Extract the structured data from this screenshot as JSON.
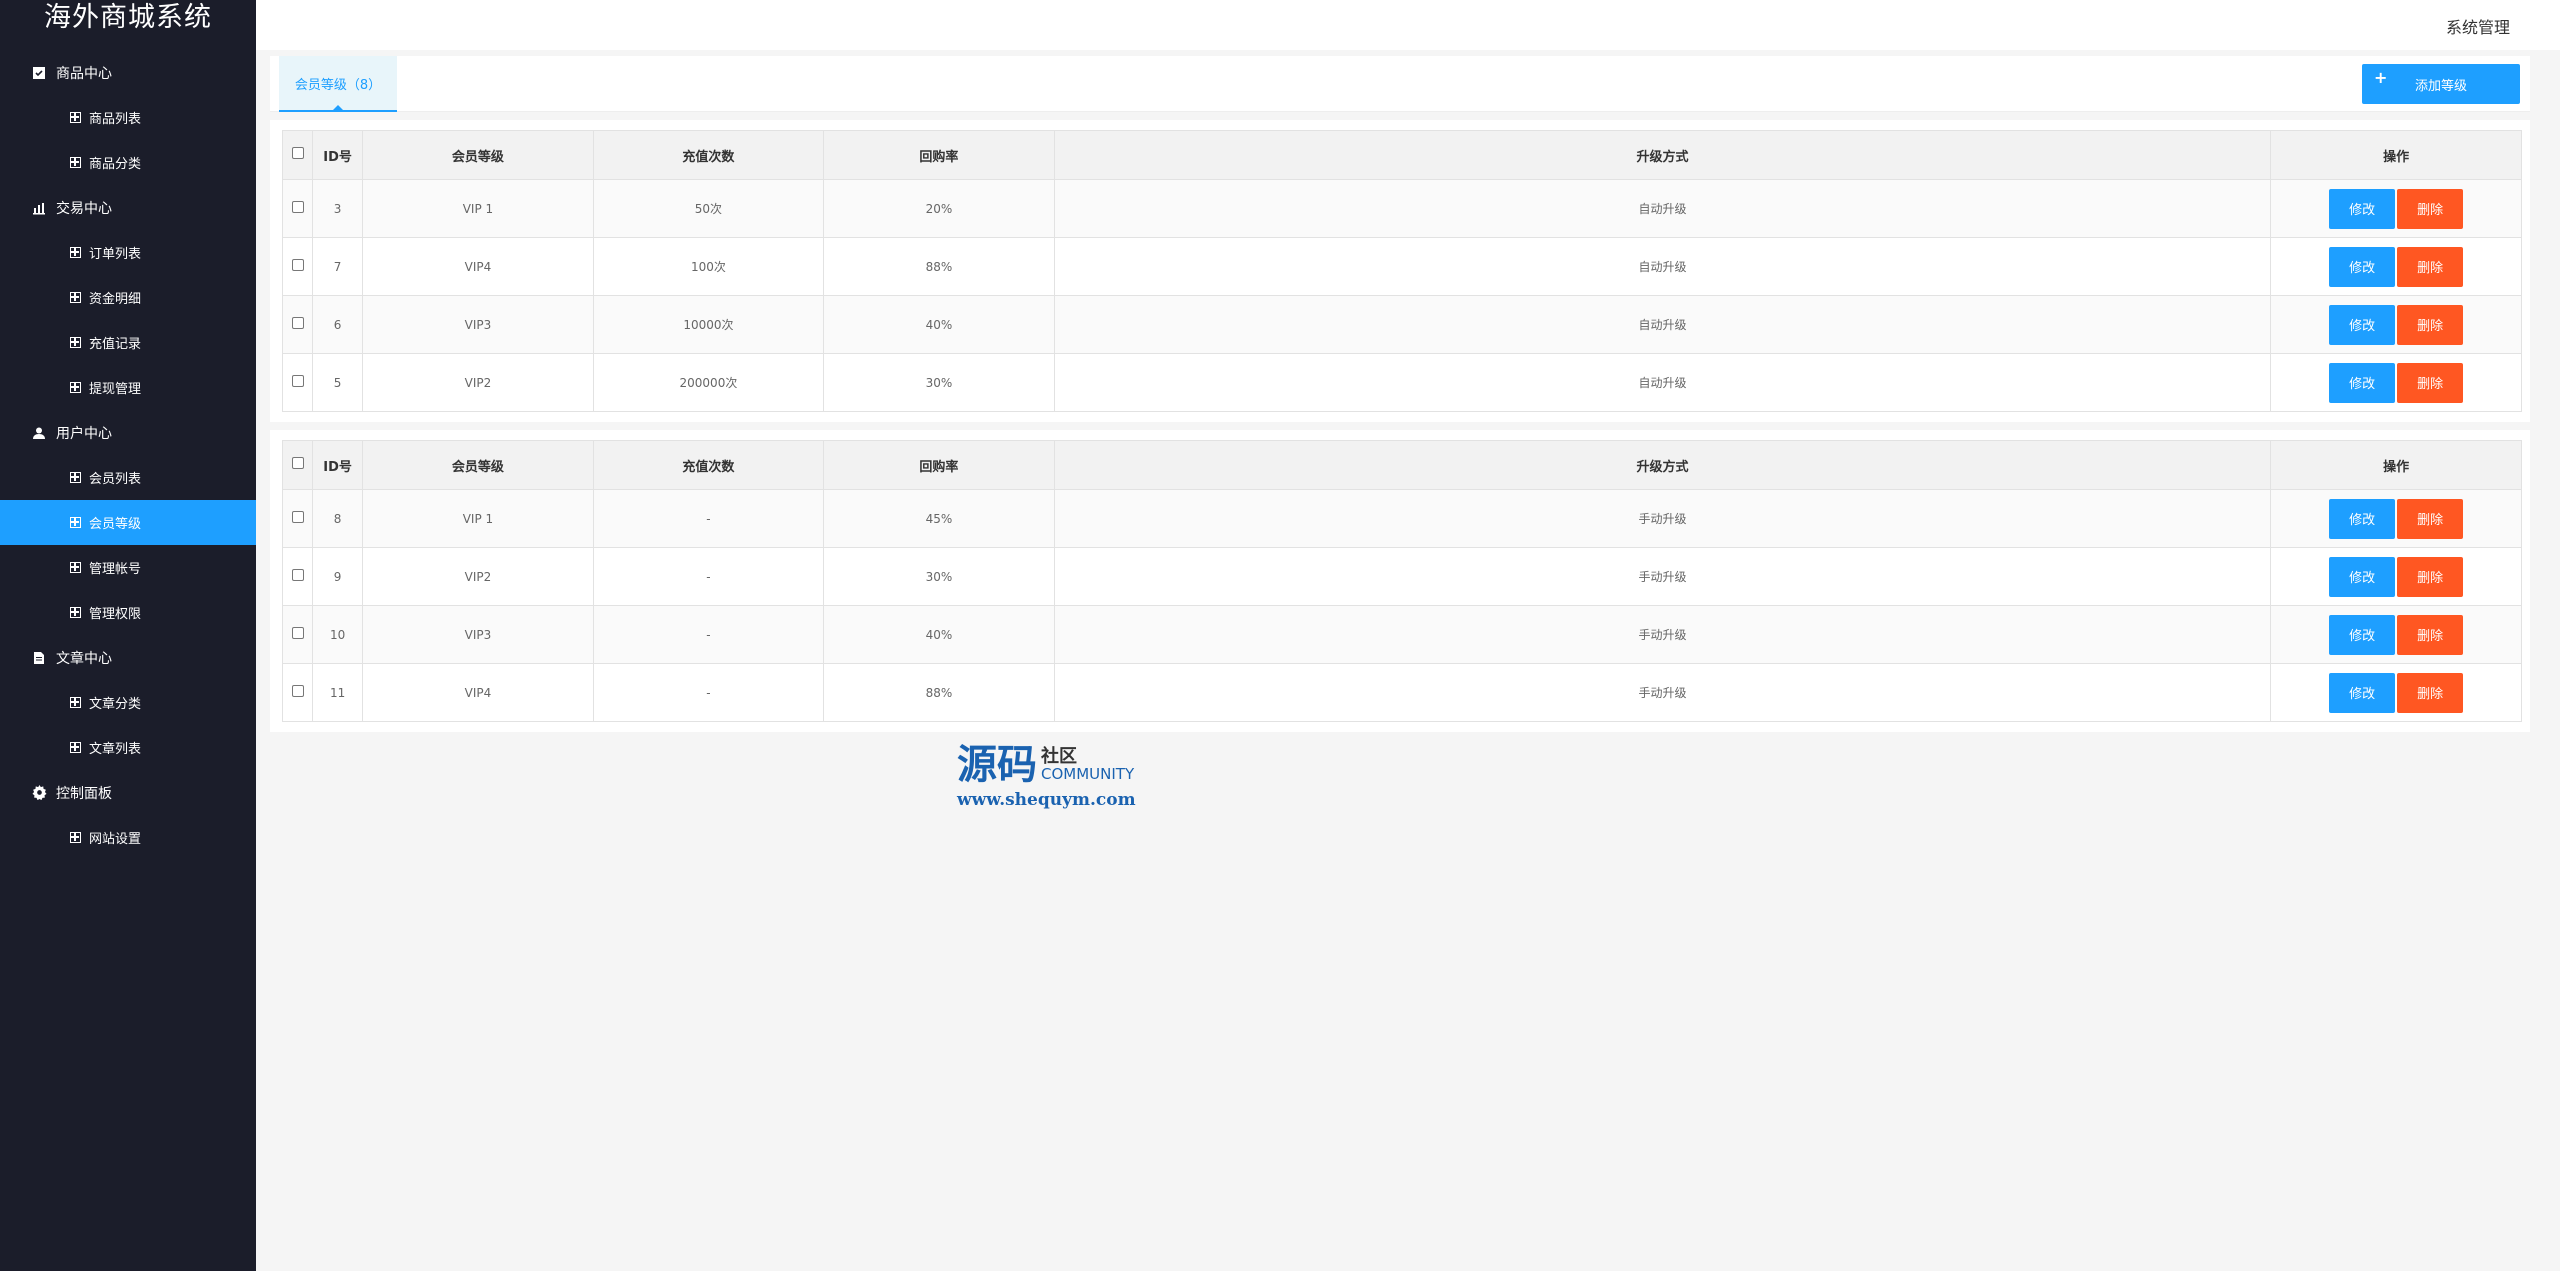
{
  "brand": "海外商城系统",
  "topbar": {
    "right_label": "系统管理"
  },
  "sidebar": {
    "groups": [
      {
        "label": "商品中心",
        "icon": "product-icon",
        "items": [
          "商品列表",
          "商品分类"
        ]
      },
      {
        "label": "交易中心",
        "icon": "bar-chart-icon",
        "items": [
          "订单列表",
          "资金明细",
          "充值记录",
          "提现管理"
        ]
      },
      {
        "label": "用户中心",
        "icon": "user-icon",
        "items": [
          "会员列表",
          "会员等级",
          "管理帐号",
          "管理权限"
        ]
      },
      {
        "label": "文章中心",
        "icon": "document-icon",
        "items": [
          "文章分类",
          "文章列表"
        ]
      },
      {
        "label": "控制面板",
        "icon": "gear-icon",
        "items": [
          "网站设置"
        ]
      }
    ],
    "active_item": "会员等级"
  },
  "tabs": {
    "active_label": "会员等级（8）"
  },
  "add_button": {
    "label": "添加等级"
  },
  "table_headers": [
    "ID号",
    "会员等级",
    "充值次数",
    "回购率",
    "升级方式",
    "操作"
  ],
  "row_actions": {
    "edit": "修改",
    "delete": "删除"
  },
  "table_auto": [
    {
      "id": "3",
      "level": "VIP 1",
      "count": "50次",
      "rate": "20%",
      "mode": "自动升级"
    },
    {
      "id": "7",
      "level": "VIP4",
      "count": "100次",
      "rate": "88%",
      "mode": "自动升级"
    },
    {
      "id": "6",
      "level": "VIP3",
      "count": "10000次",
      "rate": "40%",
      "mode": "自动升级"
    },
    {
      "id": "5",
      "level": "VIP2",
      "count": "200000次",
      "rate": "30%",
      "mode": "自动升级"
    }
  ],
  "table_manual": [
    {
      "id": "8",
      "level": "VIP 1",
      "count": "-",
      "rate": "45%",
      "mode": "手动升级"
    },
    {
      "id": "9",
      "level": "VIP2",
      "count": "-",
      "rate": "30%",
      "mode": "手动升级"
    },
    {
      "id": "10",
      "level": "VIP3",
      "count": "-",
      "rate": "40%",
      "mode": "手动升级"
    },
    {
      "id": "11",
      "level": "VIP4",
      "count": "-",
      "rate": "88%",
      "mode": "手动升级"
    }
  ],
  "watermark": {
    "big": "源码",
    "side": "社区",
    "community": "COMMUNITY",
    "url": "www.shequym.com"
  },
  "colors": {
    "sidebar_bg": "#1b1d2a",
    "accent": "#1e9fff",
    "danger": "#ff5722"
  }
}
